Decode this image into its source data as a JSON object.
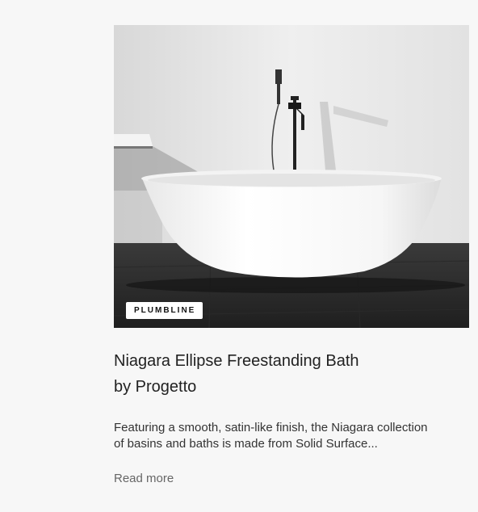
{
  "card": {
    "category": "PLUMBLINE",
    "title_line1": "Niagara Ellipse Freestanding Bath",
    "title_line2": "by Progetto",
    "excerpt_line1": "Featuring a smooth, satin-like finish, the Niagara collection",
    "excerpt_line2": "of basins and baths is made from Solid Surface...",
    "read_more": "Read more"
  }
}
